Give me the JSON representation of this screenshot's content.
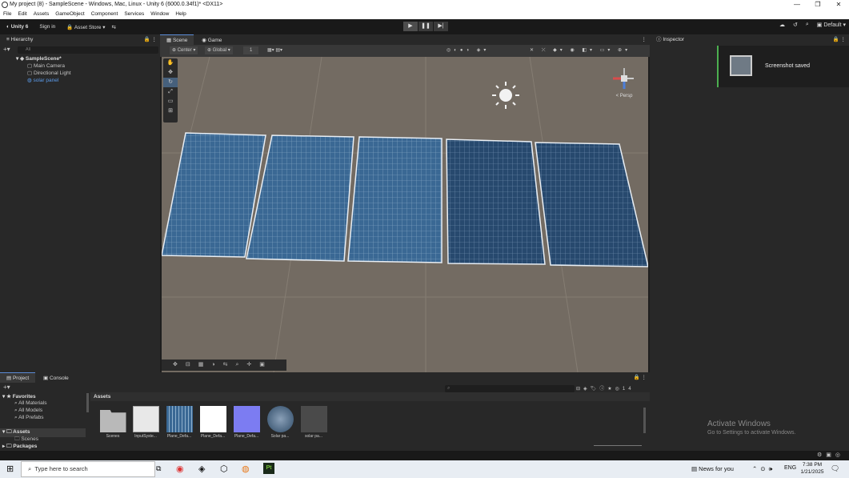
{
  "window": {
    "title": "My project (8) - SampleScene - Windows, Mac, Linux - Unity 6 (6000.0.34f1)* <DX11>",
    "min": "—",
    "max": "❐",
    "close": "✕"
  },
  "menu": [
    "File",
    "Edit",
    "Assets",
    "GameObject",
    "Component",
    "Services",
    "Window",
    "Help"
  ],
  "toolbar": {
    "account": "Unity 6",
    "signin": "Sign in",
    "asset_store": "Asset Store",
    "layout": "Default"
  },
  "hierarchy": {
    "tab": "Hierarchy",
    "search_placeholder": "All",
    "scene": "SampleScene*",
    "items": [
      "Main Camera",
      "Directional Light",
      "solar panel"
    ]
  },
  "scene_tabs": {
    "scene": "Scene",
    "game": "Game"
  },
  "scene_toolbar": {
    "pivot": "Center",
    "space": "Global",
    "grid": "1"
  },
  "gizmo": {
    "label": "< Persp"
  },
  "inspector": {
    "tab": "Inspector"
  },
  "notification": {
    "text": "Screenshot saved"
  },
  "project": {
    "tab1": "Project",
    "tab2": "Console",
    "favorites": "Favorites",
    "fav_items": [
      "All Materials",
      "All Models",
      "All Prefabs"
    ],
    "assets": "Assets",
    "asset_children": [
      "Scenes"
    ],
    "packages": "Packages",
    "breadcrumb": "Assets",
    "hidden_count": "14"
  },
  "asset_items": [
    "Scenes",
    "InputSyste...",
    "Plane_Defa...",
    "Plane_Defa...",
    "Plane_Defa...",
    "Solar pa...",
    "solar pa..."
  ],
  "activate": {
    "line1": "Activate Windows",
    "line2": "Go to Settings to activate Windows."
  },
  "taskbar": {
    "search": "Type here to search",
    "news": "News for you",
    "lang": "ENG",
    "time": "7:38 PM",
    "date": "1/21/2025"
  },
  "colors": {
    "accent": "#5b8bd6",
    "panel": "#282828",
    "ground": "#736b62",
    "panel_blue": "#2e5a85"
  }
}
